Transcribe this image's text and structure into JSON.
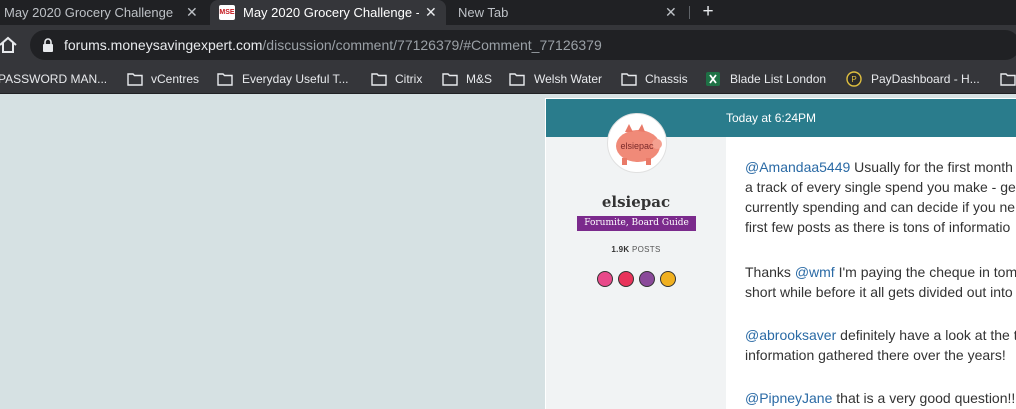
{
  "tabs": [
    {
      "title": "May 2020 Grocery Challenge -",
      "active": false
    },
    {
      "title": "May 2020 Grocery Challenge -",
      "active": true,
      "favicon": "MSE"
    },
    {
      "title": "New Tab",
      "active": false
    }
  ],
  "new_tab_symbol": "+",
  "close_symbol": "✕",
  "address_bar": {
    "host": "forums.moneysavingexpert.com",
    "path": "/discussion/comment/77126379/#Comment_77126379"
  },
  "bookmarks": [
    {
      "label": "PASSWORD MAN...",
      "icon": "none"
    },
    {
      "label": "vCentres",
      "icon": "folder-icon"
    },
    {
      "label": "Everyday Useful T...",
      "icon": "folder-icon"
    },
    {
      "label": "Citrix",
      "icon": "folder-icon"
    },
    {
      "label": "M&S",
      "icon": "folder-icon"
    },
    {
      "label": "Welsh Water",
      "icon": "folder-icon"
    },
    {
      "label": "Chassis",
      "icon": "folder-icon"
    },
    {
      "label": "Blade List London",
      "icon": "excel-icon"
    },
    {
      "label": "PayDashboard - H...",
      "icon": "paydashboard-icon"
    },
    {
      "label": "",
      "icon": "folder-icon"
    }
  ],
  "post": {
    "date": "Today at 6:24PM",
    "author": {
      "avatar_text": "elsiepac",
      "username": "elsiepac",
      "role": "Forumite, Board Guide",
      "post_count": "1.9K",
      "post_label": "POSTS",
      "badge_colors": [
        "#e84a8a",
        "#e8335a",
        "#8a4a9a",
        "#f0b020"
      ]
    },
    "paragraphs": [
      {
        "mention": "@Amandaa5449",
        "lines": [
          " Usually for the first month",
          "a track of every single spend you make - ge",
          "currently spending and can decide if you ne",
          "first few posts as there is tons of informatio"
        ]
      },
      {
        "prefix": "Thanks ",
        "mention": "@wmf",
        "lines": [
          " I'm paying the cheque in tom",
          "short while before it all gets divided out into"
        ]
      },
      {
        "mention": "@abrooksaver",
        "lines": [
          " definitely have a look at the t",
          "information gathered there over the years!"
        ]
      },
      {
        "mention": "@PipneyJane",
        "lines": [
          " that is a very good question!!"
        ]
      }
    ]
  }
}
